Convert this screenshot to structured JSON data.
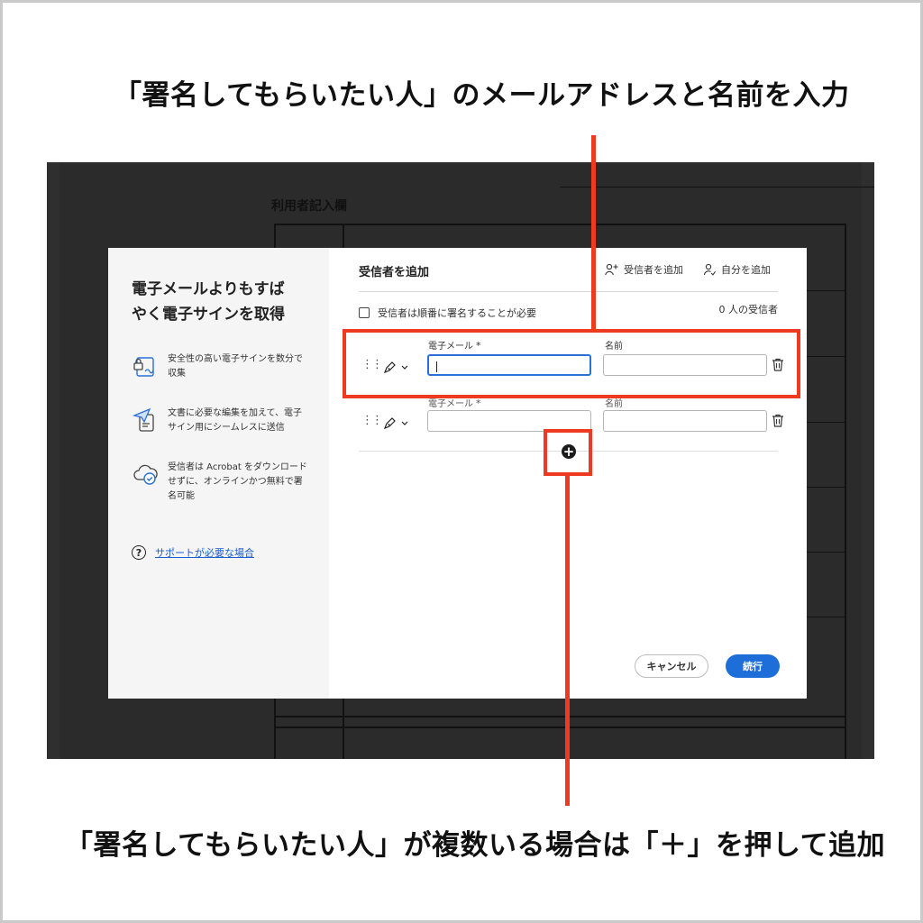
{
  "annotations": {
    "top_caption": "「署名してもらいたい人」のメールアドレスと名前を入力",
    "bottom_caption": "「署名してもらいたい人」が複数いる場合は「＋」を押して追加",
    "highlight_color": "#ee3a20"
  },
  "document": {
    "field_label": "利用者記入欄"
  },
  "promo": {
    "title_line1": "電子メールよりもすば",
    "title_line2": "やく電子サインを取得",
    "features": [
      {
        "icon": "secure-signature-icon",
        "text": "安全性の高い電子サインを数分で収集"
      },
      {
        "icon": "send-document-icon",
        "text": "文書に必要な編集を加えて、電子サイン用にシームレスに送信"
      },
      {
        "icon": "cloud-check-icon",
        "text": "受信者は Acrobat をダウンロードせずに、オンラインかつ無料で署名可能"
      }
    ],
    "support_link": "サポートが必要な場合"
  },
  "recipients_panel": {
    "title": "受信者を追加",
    "add_recipient_label": "受信者を追加",
    "add_self_label": "自分を追加",
    "sequential_label": "受信者は順番に署名することが必要",
    "recipient_count": "0 人の受信者",
    "rows": [
      {
        "email_label": "電子メール",
        "name_label": "名前",
        "email_value": "",
        "name_value": ""
      },
      {
        "email_label": "電子メール",
        "name_label": "名前",
        "email_value": "",
        "name_value": ""
      }
    ],
    "cancel_label": "キャンセル",
    "continue_label": "続行",
    "accent_color": "#1d6ed8"
  }
}
